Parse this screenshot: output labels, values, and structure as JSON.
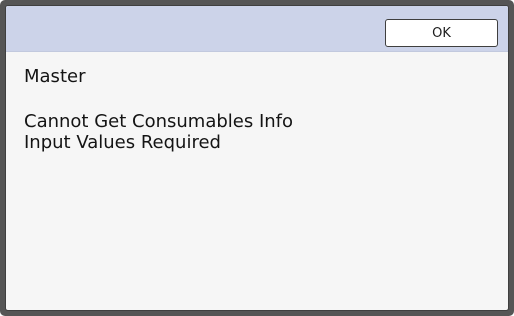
{
  "dialog": {
    "ok_label": "OK",
    "title": "Master",
    "messages": [
      "Cannot Get Consumables Info",
      "Input Values Required"
    ]
  },
  "colors": {
    "frame": "#555555",
    "panel_background": "#f6f6f6",
    "header_background": "#ccd3e9",
    "button_background": "#ffffff",
    "text": "#141414"
  }
}
